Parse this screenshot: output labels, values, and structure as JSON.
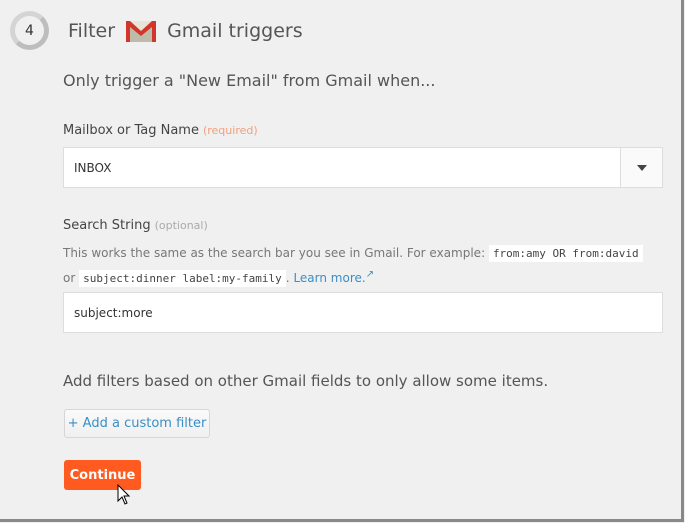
{
  "header": {
    "step_number": "4",
    "title_prefix": "Filter",
    "title_suffix": "Gmail triggers",
    "app_icon": "gmail-icon"
  },
  "intro": "Only trigger a \"New Email\" from Gmail when...",
  "mailbox": {
    "label": "Mailbox or Tag Name",
    "hint": "(required)",
    "value": "INBOX"
  },
  "search": {
    "label": "Search String",
    "hint": "(optional)",
    "help_1": "This works the same as the search bar you see in Gmail. For example:",
    "example_1": "from:amy OR from:david",
    "or": "or",
    "example_2": "subject:dinner label:my-family",
    "period": ".",
    "learn_more": "Learn more.",
    "value": "subject:more"
  },
  "filters": {
    "text": "Add filters based on other Gmail fields to only allow some items.",
    "add_button": "+ Add a custom filter"
  },
  "continue_button": "Continue",
  "colors": {
    "accent": "#ff5a1f",
    "link": "#3a8fc4",
    "background": "#f0f0f0"
  }
}
